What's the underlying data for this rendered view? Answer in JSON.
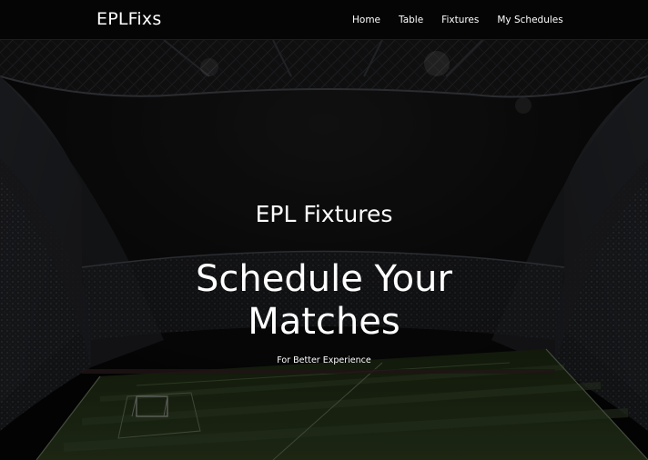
{
  "navbar": {
    "brand": "EPLFixs",
    "links": [
      {
        "label": "Home"
      },
      {
        "label": "Table"
      },
      {
        "label": "Fixtures"
      },
      {
        "label": "My Schedules"
      }
    ]
  },
  "hero": {
    "subtitle": "EPL Fixtures",
    "title_line1": "Schedule Your",
    "title_line2": "Matches",
    "tagline": "For Better Experience",
    "background": "stadium-night-image"
  },
  "colors": {
    "navbar_bg": "#050505",
    "text": "#ffffff",
    "pitch": "#1d2a12"
  }
}
